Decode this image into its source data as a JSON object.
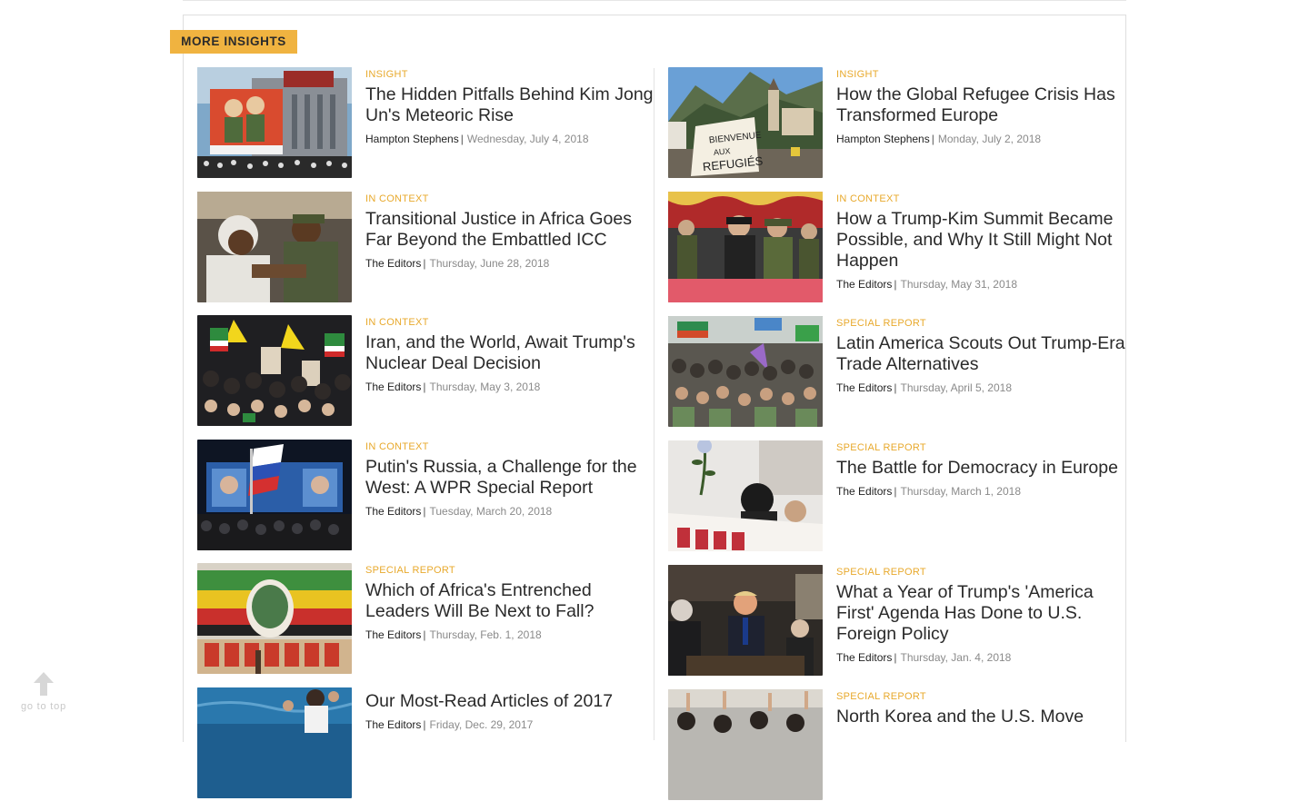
{
  "section": {
    "title": "MORE INSIGHTS"
  },
  "left_column": [
    {
      "category": "INSIGHT",
      "headline": "The Hidden Pitfalls Behind Kim Jong Un's Meteoric Rise",
      "author": "Hampton Stephens",
      "date": "Wednesday, July 4, 2018",
      "thumb_icon": "north-korea-propaganda-photo"
    },
    {
      "category": "IN CONTEXT",
      "headline": "Transitional Justice in Africa Goes Far Beyond the Embattled ICC",
      "author": "The Editors",
      "date": "Thursday, June 28, 2018",
      "thumb_icon": "courtroom-photo"
    },
    {
      "category": "IN CONTEXT",
      "headline": "Iran, and the World, Await Trump's Nuclear Deal Decision",
      "author": "The Editors",
      "date": "Thursday, May 3, 2018",
      "thumb_icon": "iran-rally-photo"
    },
    {
      "category": "IN CONTEXT",
      "headline": "Putin's Russia, a Challenge for the West: A WPR Special Report",
      "author": "The Editors",
      "date": "Tuesday, March 20, 2018",
      "thumb_icon": "russia-rally-photo"
    },
    {
      "category": "SPECIAL REPORT",
      "headline": "Which of Africa's Entrenched Leaders Will Be Next to Fall?",
      "author": "The Editors",
      "date": "Thursday, Feb. 1, 2018",
      "thumb_icon": "mural-photo"
    },
    {
      "category": "",
      "headline": "Our Most-Read Articles of 2017",
      "author": "The Editors",
      "date": "Friday, Dec. 29, 2017",
      "thumb_icon": "migrants-sea-photo"
    }
  ],
  "right_column": [
    {
      "category": "INSIGHT",
      "headline": "How the Global Refugee Crisis Has Transformed Europe",
      "author": "Hampton Stephens",
      "date": "Monday, July 2, 2018",
      "thumb_icon": "welcome-refugees-banner-photo"
    },
    {
      "category": "IN CONTEXT",
      "headline": "How a Trump-Kim Summit Became Possible, and Why It Still Might Not Happen",
      "author": "The Editors",
      "date": "Thursday, May 31, 2018",
      "thumb_icon": "kim-military-photo"
    },
    {
      "category": "SPECIAL REPORT",
      "headline": "Latin America Scouts Out Trump-Era Trade Alternatives",
      "author": "The Editors",
      "date": "Thursday, April 5, 2018",
      "thumb_icon": "latin-america-protest-photo"
    },
    {
      "category": "SPECIAL REPORT",
      "headline": "The Battle for Democracy in Europe",
      "author": "The Editors",
      "date": "Thursday, March 1, 2018",
      "thumb_icon": "protester-rose-photo"
    },
    {
      "category": "SPECIAL REPORT",
      "headline": "What a Year of Trump's 'America First' Agenda Has Done to U.S. Foreign Policy",
      "author": "The Editors",
      "date": "Thursday, Jan. 4, 2018",
      "thumb_icon": "trump-meeting-photo"
    },
    {
      "category": "SPECIAL REPORT",
      "headline": "North Korea and the U.S. Move",
      "author": "",
      "date": "",
      "thumb_icon": "crowd-photo"
    }
  ],
  "go_top": {
    "label": "go to top",
    "icon": "arrow-up-icon"
  },
  "colors": {
    "accent": "#f0b340",
    "category": "#e8a92c"
  }
}
